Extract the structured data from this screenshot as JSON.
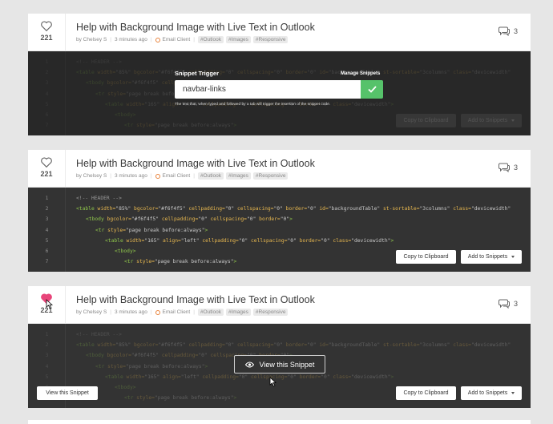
{
  "snippets": [
    {
      "votes": "221",
      "title": "Help with Background Image with Live Text in Outlook",
      "author": "by  Chelsey S",
      "time": "3 minutes ago",
      "client": "Email Client",
      "tags": [
        "#Outlook",
        "#Images",
        "#Responsive"
      ],
      "comments": "3",
      "liked": false
    },
    {
      "votes": "221",
      "title": "Help with Background Image with Live Text in Outlook",
      "author": "by  Chelsey S",
      "time": "3 minutes ago",
      "client": "Email Client",
      "tags": [
        "#Outlook",
        "#Images",
        "#Responsive"
      ],
      "comments": "3",
      "liked": false
    },
    {
      "votes": "221",
      "title": "Help with Background Image with Live Text in Outlook",
      "author": "by  Chelsey S",
      "time": "3 minutes ago",
      "client": "Email Client",
      "tags": [
        "#Outlook",
        "#Images",
        "#Responsive"
      ],
      "comments": "3",
      "liked": true
    }
  ],
  "code_lines": [
    {
      "n": "1",
      "indent": 0,
      "parts": [
        [
          "cm",
          "<!-- HEADER -->"
        ]
      ]
    },
    {
      "n": "2",
      "indent": 0,
      "parts": [
        [
          "tg",
          "<table "
        ],
        [
          "at",
          "width="
        ],
        [
          "st",
          "\"85%\" "
        ],
        [
          "at",
          "bgcolor="
        ],
        [
          "st",
          "\"#f6f4f5\" "
        ],
        [
          "at",
          "cellpadding="
        ],
        [
          "st",
          "\"0\" "
        ],
        [
          "at",
          "cellspacing="
        ],
        [
          "st",
          "\"0\" "
        ],
        [
          "at",
          "border="
        ],
        [
          "st",
          "\"0\" "
        ],
        [
          "at",
          "id="
        ],
        [
          "st",
          "\"backgroundTable\" "
        ],
        [
          "at",
          "st-sortable="
        ],
        [
          "st",
          "\"3columns\" "
        ],
        [
          "at",
          "class="
        ],
        [
          "st",
          "\"devicewidth\""
        ]
      ]
    },
    {
      "n": "3",
      "indent": 1,
      "parts": [
        [
          "tg",
          "<tbody "
        ],
        [
          "at",
          "bgcolor="
        ],
        [
          "st",
          "\"#f6f4f5\" "
        ],
        [
          "at",
          "cellpadding="
        ],
        [
          "st",
          "\"0\" "
        ],
        [
          "at",
          "cellspacing="
        ],
        [
          "st",
          "\"0\" "
        ],
        [
          "at",
          "border="
        ],
        [
          "st",
          "\"0\""
        ],
        [
          "tg",
          ">"
        ]
      ]
    },
    {
      "n": "4",
      "indent": 2,
      "parts": [
        [
          "tg",
          "<tr "
        ],
        [
          "at",
          "style="
        ],
        [
          "st",
          "\"page break before:always\""
        ],
        [
          "tg",
          ">"
        ]
      ]
    },
    {
      "n": "5",
      "indent": 3,
      "parts": [
        [
          "tg",
          "<table "
        ],
        [
          "at",
          "width="
        ],
        [
          "st",
          "\"165\" "
        ],
        [
          "at",
          "align="
        ],
        [
          "st",
          "\"left\" "
        ],
        [
          "at",
          "cellpadding="
        ],
        [
          "st",
          "\"0\" "
        ],
        [
          "at",
          "cellspacing="
        ],
        [
          "st",
          "\"0\" "
        ],
        [
          "at",
          "border="
        ],
        [
          "st",
          "\"0\" "
        ],
        [
          "at",
          "class="
        ],
        [
          "st",
          "\"devicewidth\""
        ],
        [
          "tg",
          ">"
        ]
      ]
    },
    {
      "n": "6",
      "indent": 4,
      "parts": [
        [
          "tg",
          "<tbody>"
        ]
      ]
    },
    {
      "n": "7",
      "indent": 5,
      "parts": [
        [
          "tg",
          "<tr "
        ],
        [
          "at",
          "style="
        ],
        [
          "st",
          "\"page break before:always\""
        ],
        [
          "tg",
          ">"
        ]
      ]
    }
  ],
  "buttons": {
    "copy": "Copy to Clipboard",
    "add": "Add to Snippets",
    "view": "View this Snippet"
  },
  "trigger": {
    "label": "Snippet Trigger",
    "manage": "Manage Snippets",
    "value": "navbar-links",
    "help": "The text that, when typed and followed by a tab will trigger the insertion of the snippet code."
  },
  "colors": {
    "accent_green": "#56c26a",
    "heart_active": "#e8457a",
    "code_bg": "#333333"
  }
}
